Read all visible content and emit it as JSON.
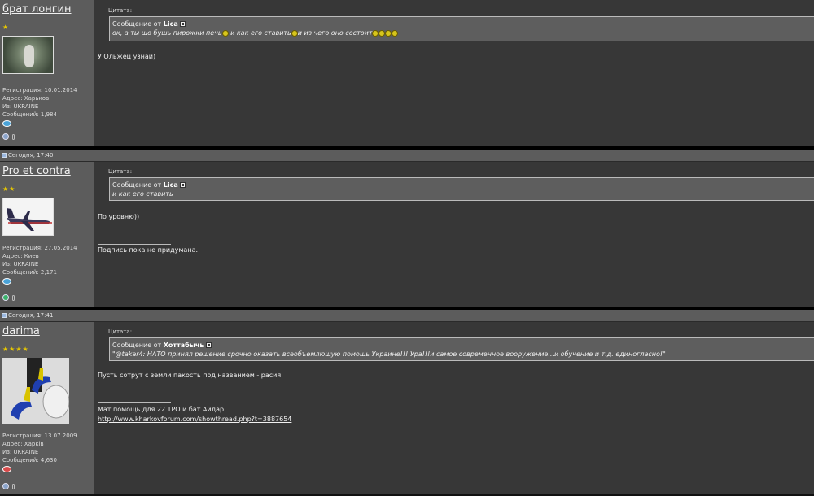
{
  "posts": [
    {
      "username": "брат лонгин",
      "stars": "★",
      "userinfo": {
        "registration": "Регистрация: 10.01.2014",
        "address": "Адрес: Харьков",
        "from": "Из: UKRAINE",
        "messages": "Сообщений: 1,984"
      },
      "quote_label": "Цитата:",
      "quote_author_prefix": "Сообщение от",
      "quote_author": "Lica",
      "quote_text_parts": [
        "ок, а ты шо бушь пирожки печь",
        " и как его ставить",
        "и из чего оно состоит"
      ],
      "text": "У Ольжец узнай)",
      "signature_line1": "",
      "signature_link": ""
    },
    {
      "date": "Сегодня, 17:40",
      "username": "Pro et contra",
      "stars": "★★",
      "userinfo": {
        "registration": "Регистрация: 27.05.2014",
        "address": "Адрес: Киев",
        "from": "Из: UKRAINE",
        "messages": "Сообщений: 2,171"
      },
      "quote_label": "Цитата:",
      "quote_author_prefix": "Сообщение от",
      "quote_author": "Lica",
      "quote_text": "и как его ставить",
      "text": "По уровню))",
      "signature_line1": "Подпись пока не придумана."
    },
    {
      "date": "Сегодня, 17:41",
      "username": "darima",
      "stars": "★★★★",
      "userinfo": {
        "registration": "Регистрация: 13.07.2009",
        "address": "Адрес: Харків",
        "from": "Из: UKRAINE",
        "messages": "Сообщений: 4,630"
      },
      "quote_label": "Цитата:",
      "quote_author_prefix": "Сообщение от",
      "quote_author": "Хоттабычь",
      "quote_text": "\"@takar4: НАТО принял решение срочно оказать всеобъемлющую помощь Украине!!! Ура!!!и самое современное вооружение...и обучение и т.д. единогласно!\"",
      "text": "Пусть сотрут с земли пакость под названием - расия",
      "signature_line1": "Мат помощь для 22 ТРО и бат Айдар:",
      "signature_link": "http://www.kharkovforum.com/showthread.php?t=3887654"
    }
  ],
  "colors": {
    "sidebar": "#5c5c5c",
    "body": "#373737",
    "quote": "#5e5e5e",
    "star": "#e8c800"
  }
}
